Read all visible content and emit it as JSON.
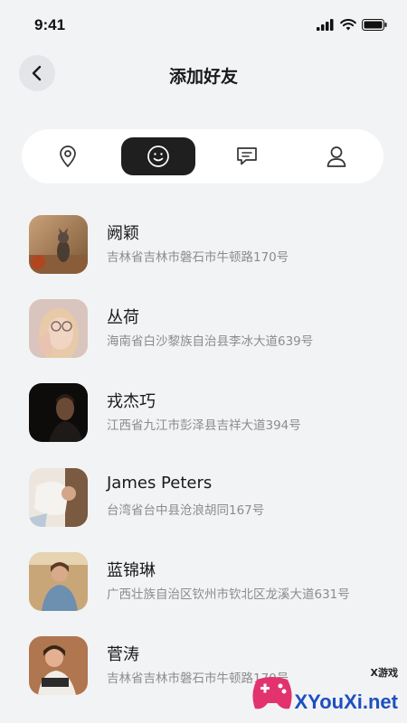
{
  "status_bar": {
    "time": "9:41"
  },
  "header": {
    "title": "添加好友"
  },
  "tabs": [
    {
      "icon": "location-pin-icon",
      "active": false
    },
    {
      "icon": "smiley-face-icon",
      "active": true
    },
    {
      "icon": "message-icon",
      "active": false
    },
    {
      "icon": "person-icon",
      "active": false
    }
  ],
  "friends": [
    {
      "name": "阙颖",
      "address": "吉林省吉林市磐石市牛顿路170号"
    },
    {
      "name": "丛荷",
      "address": "海南省白沙黎族自治县李冰大道639号"
    },
    {
      "name": "戎杰巧",
      "address": "江西省九江市彭泽县吉祥大道394号"
    },
    {
      "name": "James Peters",
      "address": "台湾省台中县沧浪胡同167号"
    },
    {
      "name": "蓝锦琳",
      "address": "广西壮族自治区钦州市钦北区龙溪大道631号"
    },
    {
      "name": "菅涛",
      "address": "吉林省吉林市磐石市牛顿路170号"
    }
  ],
  "watermark": {
    "tag": "X游戏",
    "text": "XYouXi.net"
  },
  "colors": {
    "background": "#f2f3f5",
    "active_tab": "#1f1f1f",
    "text_secondary": "#8c8c8c"
  }
}
